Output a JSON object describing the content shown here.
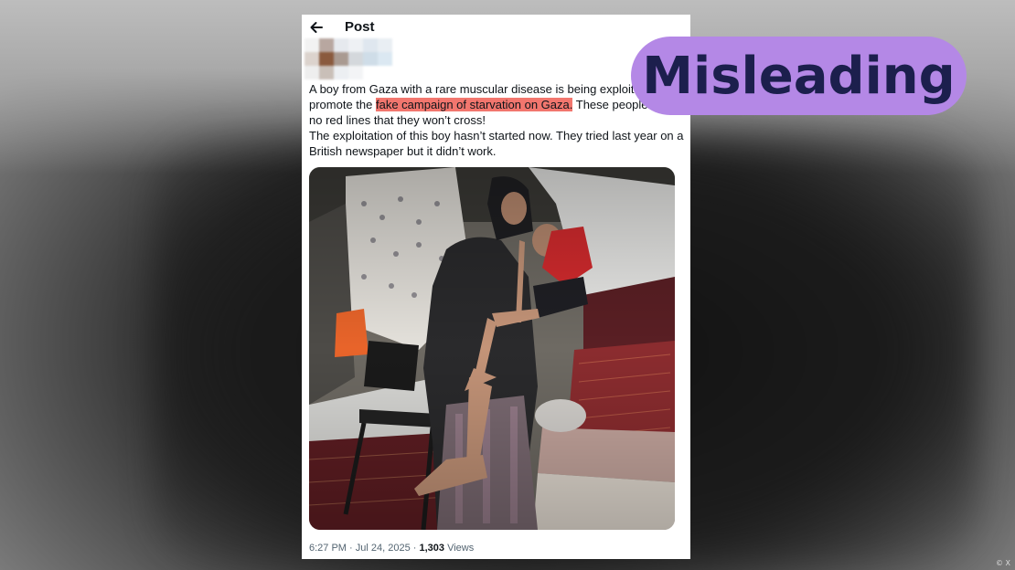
{
  "post": {
    "header_title": "Post",
    "text": {
      "part1": "A boy from Gaza with a rare muscular disease is being exploited to promote the",
      "highlight": "fake campaign of starvation on Gaza.",
      "part2": "These people have no red lines that they won’t cross!",
      "line2": "The exploitation of this boy hasn’t started now. They tried last year on a British newspaper but it didn’t work."
    },
    "meta": {
      "time": "6:27 PM",
      "date": "Jul 24, 2025",
      "separator": "·",
      "views_count": "1,303",
      "views_label": "Views"
    }
  },
  "badge": {
    "label": "Misleading"
  },
  "credit": "© X",
  "colors": {
    "highlight": "#f2766e",
    "badge_bg": "#b488e6",
    "badge_text": "#1c1f4d"
  },
  "icons": {
    "back": "arrow-left-icon"
  }
}
